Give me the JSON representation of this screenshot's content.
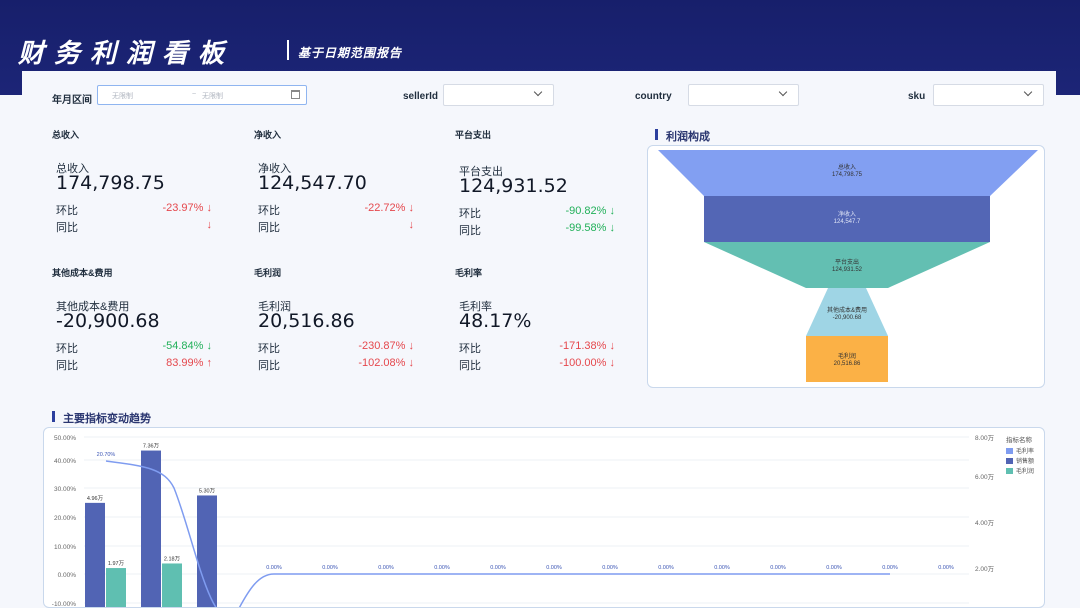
{
  "header": {
    "title": "财务利润看板",
    "subtitle": "基于日期范围报告"
  },
  "filters": {
    "month_range_label": "年月区间",
    "range_start_placeholder": "无限制",
    "range_sep": "~",
    "range_end_placeholder": "无限制",
    "seller_label": "sellerId",
    "country_label": "country",
    "sku_label": "sku"
  },
  "kpis": [
    {
      "title": "总收入",
      "label": "总收入",
      "value": "174,798.75",
      "mom_label": "环比",
      "mom": "-23.97%",
      "mom_color": "red",
      "mom_arrow": "down",
      "yoy_label": "同比",
      "yoy": "",
      "yoy_color": "red",
      "yoy_arrow": "down"
    },
    {
      "title": "净收入",
      "label": "净收入",
      "value": "124,547.70",
      "mom_label": "环比",
      "mom": "-22.72%",
      "mom_color": "red",
      "mom_arrow": "down",
      "yoy_label": "同比",
      "yoy": "",
      "yoy_color": "red",
      "yoy_arrow": "down"
    },
    {
      "title": "平台支出",
      "label": "平台支出",
      "value": "124,931.52",
      "mom_label": "环比",
      "mom": "-90.82%",
      "mom_color": "green",
      "mom_arrow": "down",
      "yoy_label": "同比",
      "yoy": "-99.58%",
      "yoy_color": "green",
      "yoy_arrow": "down"
    },
    {
      "title": "其他成本&费用",
      "label": "其他成本&费用",
      "value": "-20,900.68",
      "mom_label": "环比",
      "mom": "-54.84%",
      "mom_color": "green",
      "mom_arrow": "down",
      "yoy_label": "同比",
      "yoy": "83.99%",
      "yoy_color": "red",
      "yoy_arrow": "up"
    },
    {
      "title": "毛利润",
      "label": "毛利润",
      "value": "20,516.86",
      "mom_label": "环比",
      "mom": "-230.87%",
      "mom_color": "red",
      "mom_arrow": "down",
      "yoy_label": "同比",
      "yoy": "-102.08%",
      "yoy_color": "red",
      "yoy_arrow": "down"
    },
    {
      "title": "毛利率",
      "label": "毛利率",
      "value": "48.17%",
      "mom_label": "环比",
      "mom": "-171.38%",
      "mom_color": "red",
      "mom_arrow": "down",
      "yoy_label": "同比",
      "yoy": "-100.00%",
      "yoy_color": "red",
      "yoy_arrow": "down"
    }
  ],
  "colors": {
    "red": "#e5484d",
    "green": "#22b05a",
    "blue_light": "#7f9cf0",
    "blue_dark": "#5164b4",
    "teal": "#5fbfb1",
    "sky": "#9dd4e6",
    "orange": "#fbb040"
  },
  "funnel": {
    "title": "利润构成",
    "stages": [
      {
        "name": "总收入",
        "value": "174,798.75",
        "color": "#829ff2"
      },
      {
        "name": "净收入",
        "value": "124,547.7",
        "color": "#5366b5"
      },
      {
        "name": "平台支出",
        "value": "124,931.52",
        "color": "#63bfb2"
      },
      {
        "name": "其他成本&费用",
        "value": "-20,900.68",
        "color": "#9fd5e5"
      },
      {
        "name": "毛利润",
        "value": "20,516.86",
        "color": "#fbb146"
      }
    ]
  },
  "trend": {
    "title": "主要指标变动趋势",
    "chart_data": {
      "type": "bar",
      "left_axis_ticks": [
        "50.00%",
        "40.00%",
        "30.00%",
        "20.00%",
        "10.00%",
        "0.00%",
        "-10.00%"
      ],
      "right_axis_ticks": [
        "8.00万",
        "6.00万",
        "4.00万",
        "2.00万"
      ],
      "legend_title": "指标名称",
      "series": [
        {
          "name": "毛利率",
          "kind": "line",
          "values": [
            20.7,
            19.0,
            0.0,
            0.0,
            0.0,
            0.0,
            0.0,
            0.0,
            0.0,
            0.0,
            0.0,
            0.0,
            0.0,
            0.0,
            0.0
          ],
          "labels": [
            "20.70%",
            "",
            "0.00%",
            "0.00%",
            "0.00%",
            "0.00%",
            "0.00%",
            "0.00%",
            "0.00%",
            "0.00%",
            "0.00%",
            "0.00%",
            "0.00%",
            "0.00%",
            "0.00%"
          ]
        },
        {
          "name": "销售额",
          "kind": "bar",
          "values": [
            4.96,
            7.36,
            5.3
          ],
          "labels": [
            "4.96万",
            "7.36万",
            "5.30万"
          ]
        },
        {
          "name": "毛利润",
          "kind": "bar",
          "values": [
            1.97,
            2.18
          ],
          "labels": [
            "1.97万",
            "2.18万"
          ]
        }
      ]
    }
  }
}
